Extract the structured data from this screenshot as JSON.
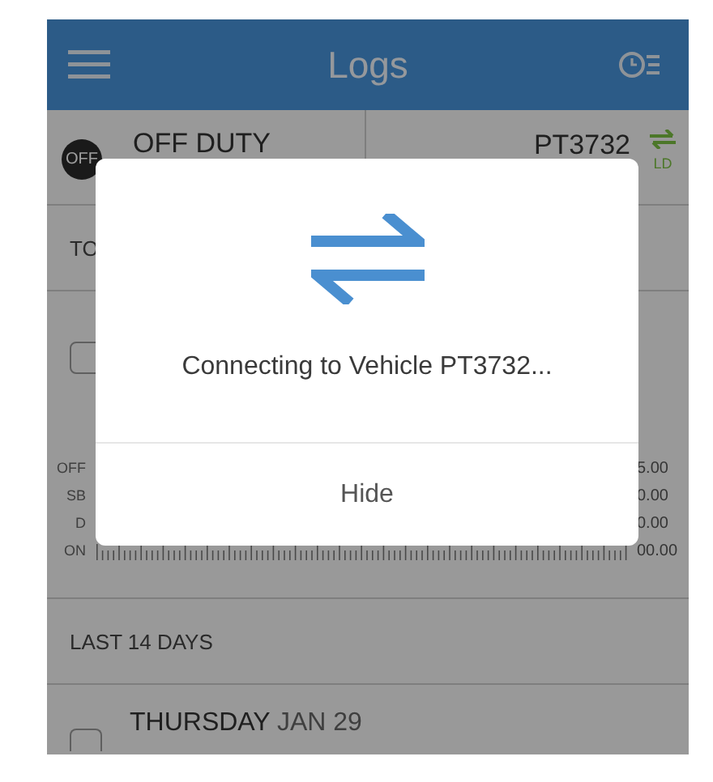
{
  "app_bar": {
    "title": "Logs"
  },
  "status": {
    "badge": "OFF",
    "duty": "OFF DUTY",
    "vehicle": "PT3732",
    "vehicle_state": "LD"
  },
  "section": {
    "label": "TO"
  },
  "chart": {
    "checked": false,
    "row_labels": [
      "OFF",
      "SB",
      "D",
      "ON"
    ],
    "totals": [
      "5.00",
      "0.00",
      "0.00",
      "00.00"
    ]
  },
  "recent": {
    "label": "LAST 14 DAYS"
  },
  "days": [
    {
      "weekday": "THURSDAY",
      "date": "JAN 29",
      "checked": false
    }
  ],
  "dialog": {
    "message": "Connecting to Vehicle PT3732...",
    "button": "Hide"
  }
}
